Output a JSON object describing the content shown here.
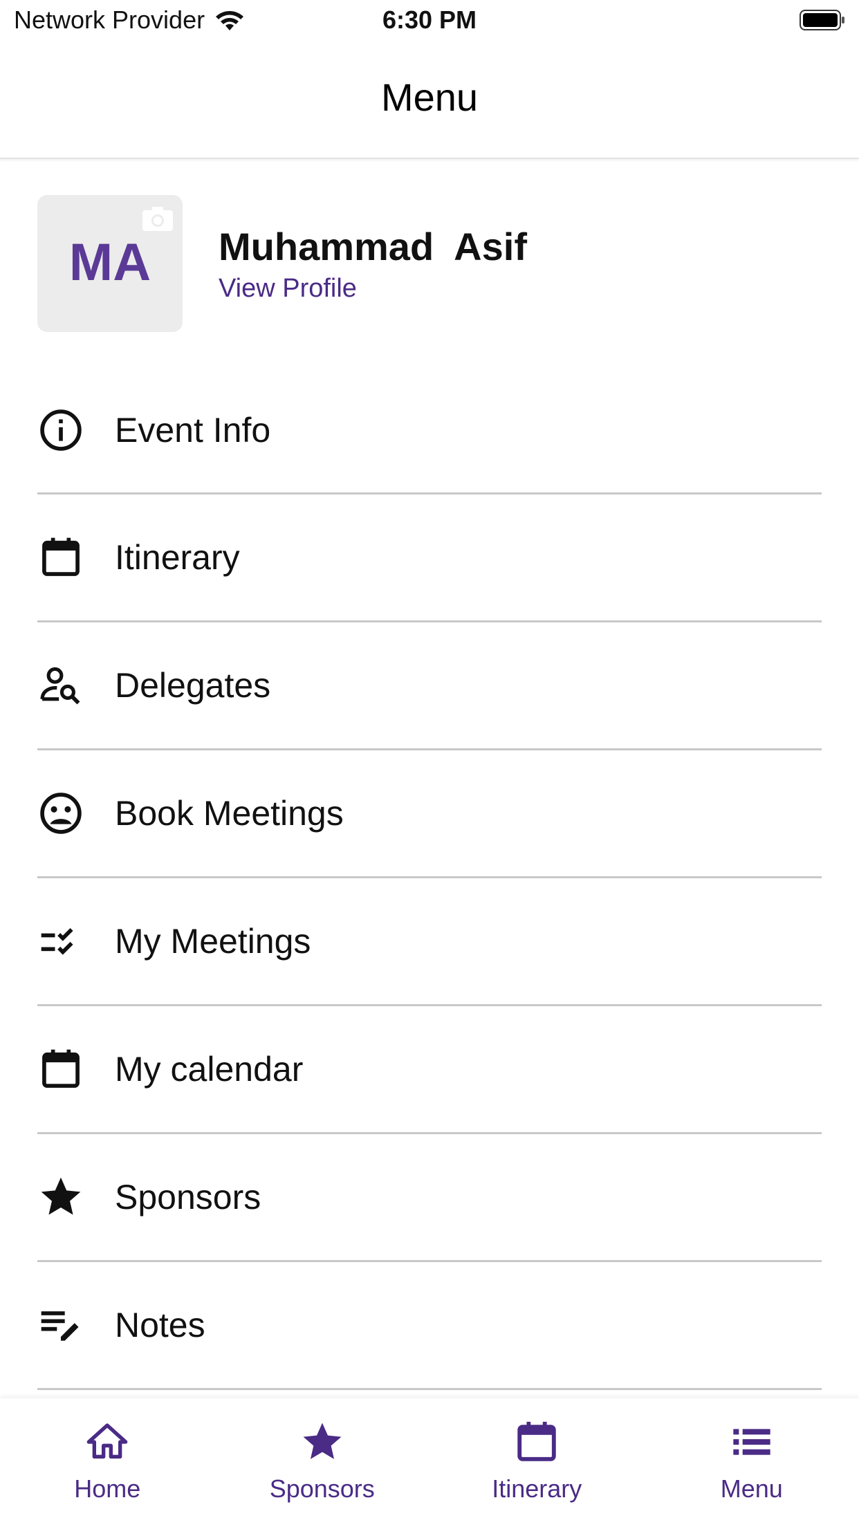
{
  "status_bar": {
    "carrier": "Network Provider",
    "time": "6:30 PM"
  },
  "header": {
    "title": "Menu"
  },
  "profile": {
    "initials": "MA",
    "name": "Muhammad  Asif",
    "link": "View Profile"
  },
  "menu": {
    "items": [
      {
        "label": "Event Info",
        "icon": "info-icon"
      },
      {
        "label": "Itinerary",
        "icon": "calendar-icon"
      },
      {
        "label": "Delegates",
        "icon": "person-search-icon"
      },
      {
        "label": "Book Meetings",
        "icon": "face-icon"
      },
      {
        "label": "My Meetings",
        "icon": "checklist-icon"
      },
      {
        "label": "My calendar",
        "icon": "calendar-icon"
      },
      {
        "label": "Sponsors",
        "icon": "star-icon"
      },
      {
        "label": "Notes",
        "icon": "notes-edit-icon"
      }
    ]
  },
  "tab_bar": {
    "tabs": [
      {
        "label": "Home",
        "icon": "home-icon"
      },
      {
        "label": "Sponsors",
        "icon": "star-icon"
      },
      {
        "label": "Itinerary",
        "icon": "calendar-icon"
      },
      {
        "label": "Menu",
        "icon": "list-icon"
      }
    ]
  },
  "colors": {
    "accent": "#4a2b86",
    "avatar_bg": "#ececec",
    "divider": "#c8c8c8"
  }
}
